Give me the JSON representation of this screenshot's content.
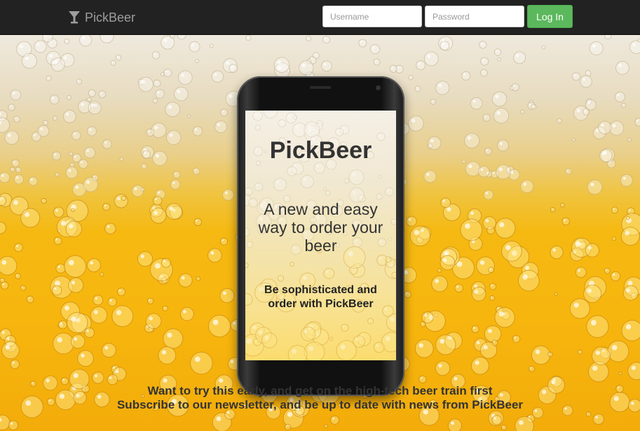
{
  "navbar": {
    "brand": {
      "label": "PickBeer",
      "icon": "martini-glass-icon"
    },
    "login": {
      "username_placeholder": "Username",
      "password_placeholder": "Password",
      "button_label": "Log In"
    }
  },
  "hero": {
    "phone_screen": {
      "title": "PickBeer",
      "tagline": "A new and easy way to order your beer",
      "subtitle": "Be sophisticated and order with PickBeer"
    },
    "cta": {
      "line1": "Want to try this early, and get on the high-tech beer train first",
      "line2": "Subscribe to our newsletter, and be up to date with news from PickBeer"
    }
  },
  "colors": {
    "navbar_bg": "#222222",
    "brand_text": "#9d9d9d",
    "login_button": "#5cb85c",
    "beer_gold": "#f5b912",
    "foam": "#efe9dd",
    "text_dark": "#333333"
  }
}
